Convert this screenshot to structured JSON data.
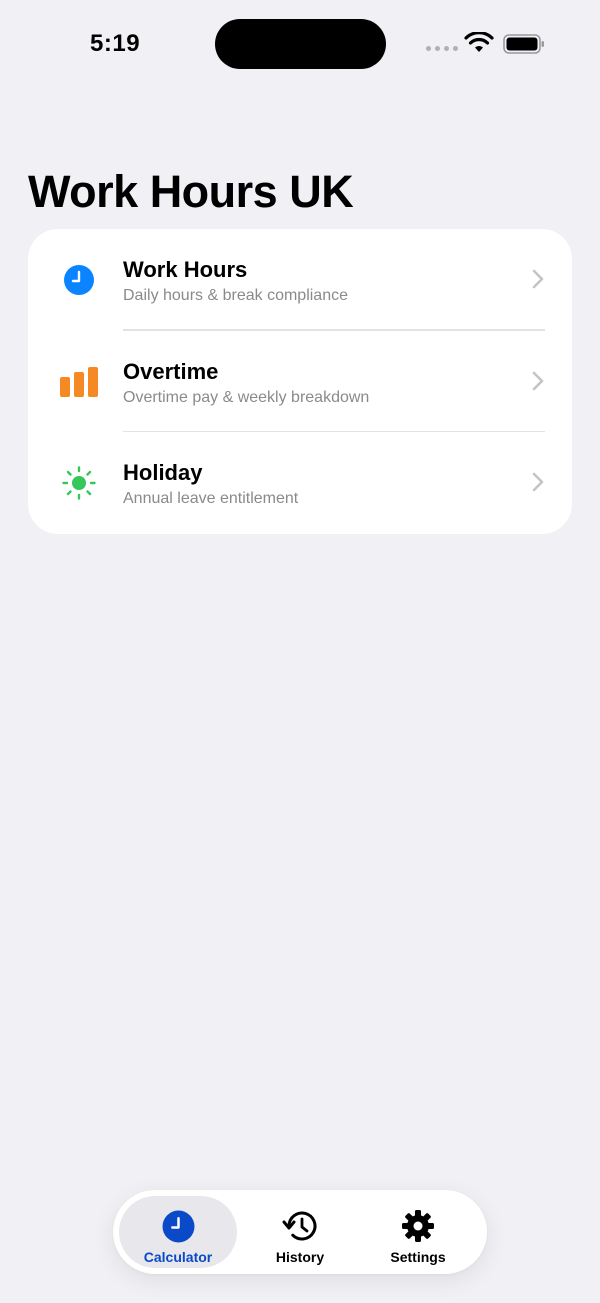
{
  "status_bar": {
    "time": "5:19"
  },
  "page": {
    "title": "Work Hours UK"
  },
  "menu": {
    "items": [
      {
        "title": "Work Hours",
        "subtitle": "Daily hours & break compliance",
        "icon": "clock-icon",
        "color": "#0a84ff"
      },
      {
        "title": "Overtime",
        "subtitle": "Overtime pay & weekly breakdown",
        "icon": "bar-chart-icon",
        "color": "#f58a25"
      },
      {
        "title": "Holiday",
        "subtitle": "Annual leave entitlement",
        "icon": "sun-icon",
        "color": "#34c759"
      }
    ]
  },
  "tab_bar": {
    "tabs": [
      {
        "label": "Calculator",
        "icon": "clock-icon",
        "active": true,
        "color": "#0a49c8"
      },
      {
        "label": "History",
        "icon": "history-icon",
        "active": false,
        "color": "#000000"
      },
      {
        "label": "Settings",
        "icon": "gear-icon",
        "active": false,
        "color": "#000000"
      }
    ]
  },
  "colors": {
    "background": "#f0f0f5",
    "card": "#ffffff",
    "subtitle": "#8a8a8e",
    "chevron": "#c4c4c7"
  }
}
